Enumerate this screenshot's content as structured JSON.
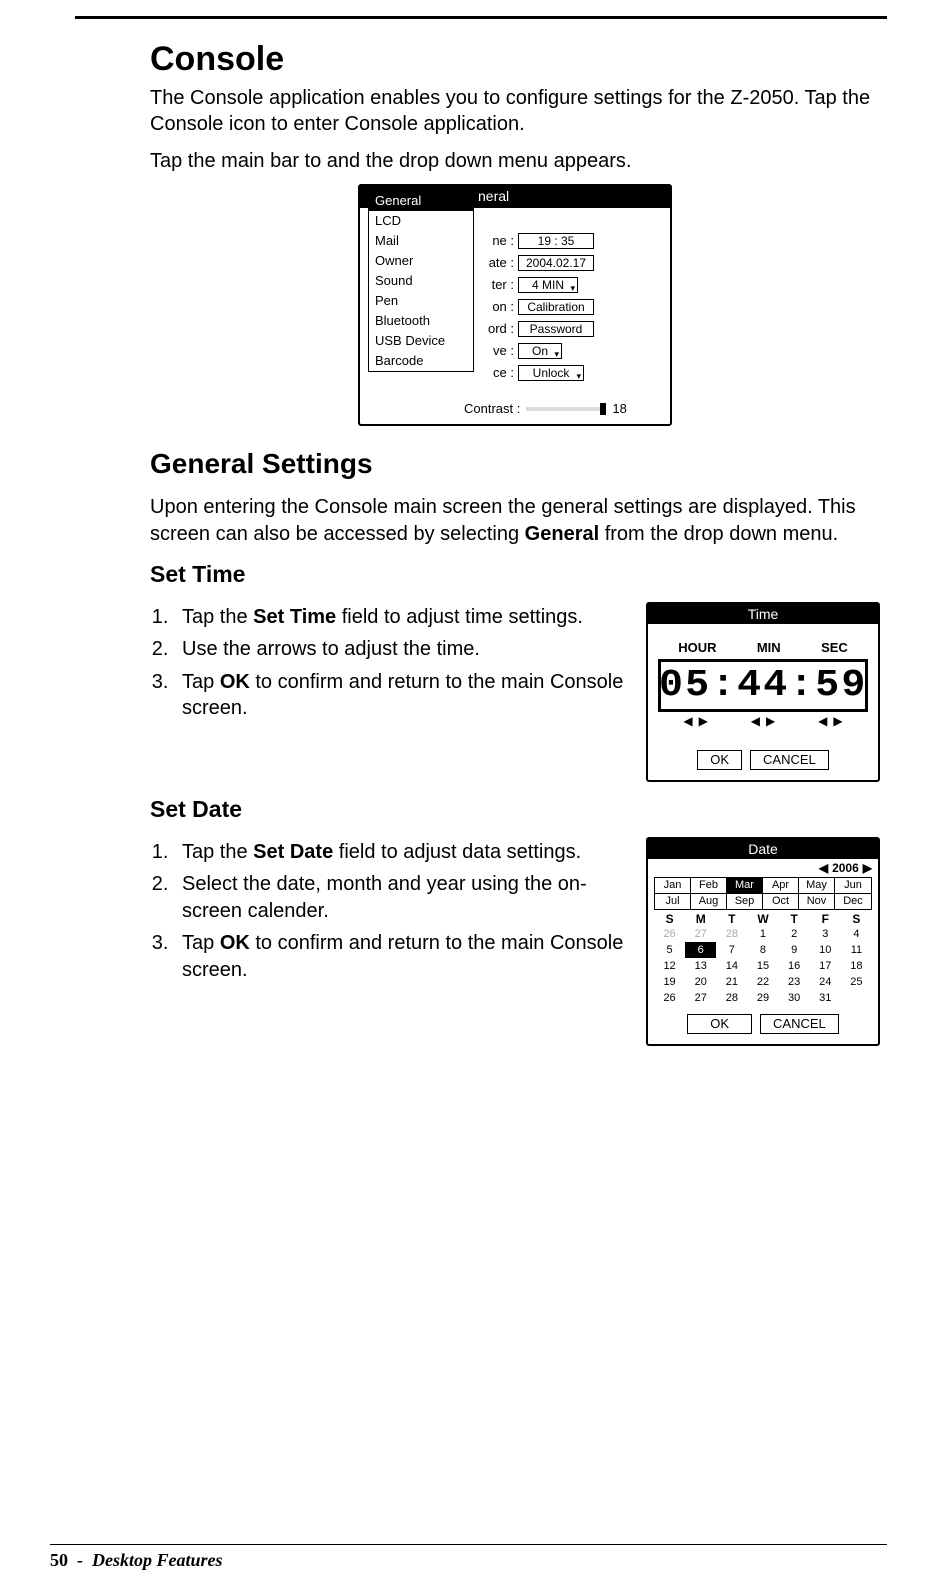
{
  "page": {
    "number": "50",
    "section": "Desktop Features"
  },
  "h1": "Console",
  "intro1": "The Console application enables you to configure settings for the Z-2050. Tap the Console icon to enter Console application.",
  "intro2": "Tap the main bar to and the drop down menu appears.",
  "console_shot": {
    "title_partial": "neral",
    "menu": [
      "General",
      "LCD",
      "Mail",
      "Owner",
      "Sound",
      "Pen",
      "Bluetooth",
      "USB Device",
      "Barcode"
    ],
    "fields": {
      "time_label": "ne :",
      "time_value": "19 : 35",
      "date_label": "ate :",
      "date_value": "2004.02.17",
      "off_label": "ter :",
      "off_value": "4 MIN",
      "cal_label": "on :",
      "cal_value": "Calibration",
      "pwd_label": "ord :",
      "pwd_value": "Password",
      "save_label": "ve :",
      "save_value": "On",
      "lock_label": "ce :",
      "lock_value": "Unlock"
    },
    "contrast_label": "Contrast :",
    "contrast_value": "18"
  },
  "h2": "General Settings",
  "gs_intro_pre": "Upon entering the Console main screen the general settings are displayed. This screen can also be accessed by selecting ",
  "gs_intro_bold": "General",
  "gs_intro_post": " from the drop down menu.",
  "set_time": {
    "heading": "Set Time",
    "steps": [
      {
        "pre": "Tap the ",
        "bold": "Set Time",
        "post": " field to adjust time settings."
      },
      {
        "pre": "Use the arrows to adjust the time.",
        "bold": "",
        "post": ""
      },
      {
        "pre": "Tap ",
        "bold": "OK",
        "post": " to confirm and return to the main Console screen."
      }
    ],
    "shot": {
      "title": "Time",
      "labels": {
        "hour": "HOUR",
        "min": "MIN",
        "sec": "SEC"
      },
      "time": "05:44:59",
      "ok": "OK",
      "cancel": "CANCEL"
    }
  },
  "set_date": {
    "heading": "Set Date",
    "steps": [
      {
        "pre": "Tap the ",
        "bold": "Set Date",
        "post": " field to adjust data settings."
      },
      {
        "pre": "Select the date, month and year using the on-screen calender.",
        "bold": "",
        "post": ""
      },
      {
        "pre": "Tap ",
        "bold": "OK",
        "post": " to confirm and return to the main Console screen."
      }
    ],
    "shot": {
      "title": "Date",
      "year": "2006",
      "months1": [
        "Jan",
        "Feb",
        "Mar",
        "Apr",
        "May",
        "Jun"
      ],
      "months2": [
        "Jul",
        "Aug",
        "Sep",
        "Oct",
        "Nov",
        "Dec"
      ],
      "month_sel": "Mar",
      "dow": [
        "S",
        "M",
        "T",
        "W",
        "T",
        "F",
        "S"
      ],
      "days": [
        [
          "26",
          "27",
          "28",
          "1",
          "2",
          "3",
          "4"
        ],
        [
          "5",
          "6",
          "7",
          "8",
          "9",
          "10",
          "11"
        ],
        [
          "12",
          "13",
          "14",
          "15",
          "16",
          "17",
          "18"
        ],
        [
          "19",
          "20",
          "21",
          "22",
          "23",
          "24",
          "25"
        ],
        [
          "26",
          "27",
          "28",
          "29",
          "30",
          "31",
          ""
        ]
      ],
      "day_sel": "6",
      "ok": "OK",
      "cancel": "CANCEL"
    }
  }
}
